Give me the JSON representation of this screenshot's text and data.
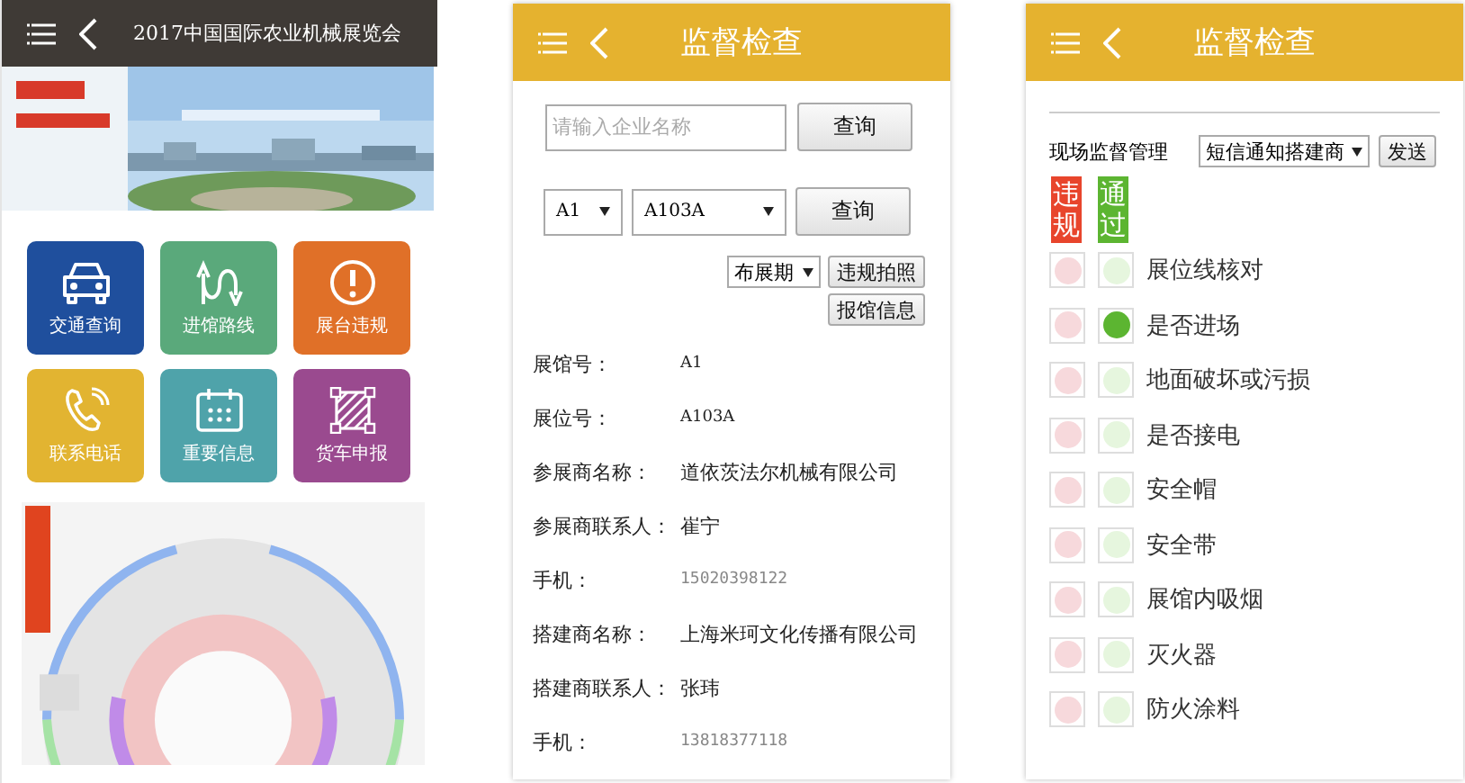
{
  "home": {
    "title": "2017中国国际农业机械展览会",
    "tiles": [
      {
        "label": "交通查询",
        "kind": "car",
        "color": "#1f4f9d"
      },
      {
        "label": "进馆路线",
        "kind": "route",
        "color": "#5aa97b"
      },
      {
        "label": "展台违规",
        "kind": "alert",
        "color": "#e07028"
      },
      {
        "label": "联系电话",
        "kind": "phone",
        "color": "#e2b431"
      },
      {
        "label": "重要信息",
        "kind": "calendar",
        "color": "#4fa3aa"
      },
      {
        "label": "货车申报",
        "kind": "frame",
        "color": "#9a4a8f"
      }
    ]
  },
  "inspection_search": {
    "title": "监督检查",
    "search": {
      "placeholder": "请输入企业名称",
      "button": "查询"
    },
    "hall_select": "A1",
    "booth_select": "A103A",
    "query_button": "查询",
    "period_select": "布展期",
    "photo_button": "违规拍照",
    "report_button": "报馆信息",
    "details": [
      {
        "label": "展馆号：",
        "value": "A1",
        "kind": "code"
      },
      {
        "label": "展位号：",
        "value": "A103A",
        "kind": "code"
      },
      {
        "label": "参展商名称：",
        "value": "道依茨法尔机械有限公司",
        "kind": "text"
      },
      {
        "label": "参展商联系人：",
        "value": "崔宁",
        "kind": "text"
      },
      {
        "label": "手机：",
        "value": "15020398122",
        "kind": "phone"
      },
      {
        "label": "搭建商名称：",
        "value": "上海米珂文化传播有限公司",
        "kind": "text"
      },
      {
        "label": "搭建商联系人：",
        "value": "张玮",
        "kind": "text"
      },
      {
        "label": "手机：",
        "value": "13818377118",
        "kind": "phone"
      }
    ]
  },
  "inspection_checklist": {
    "title": "监督检查",
    "manage_label": "现场监督管理",
    "notify_select": "短信通知搭建商",
    "send_button": "发送",
    "columns": [
      {
        "label": "违规",
        "color": "#e8452c"
      },
      {
        "label": "通过",
        "color": "#5cb531"
      }
    ],
    "items": [
      {
        "label": "展位线核对",
        "violation": false,
        "pass": false
      },
      {
        "label": "是否进场",
        "violation": false,
        "pass": true
      },
      {
        "label": "地面破坏或污损",
        "violation": false,
        "pass": false
      },
      {
        "label": "是否接电",
        "violation": false,
        "pass": false
      },
      {
        "label": "安全帽",
        "violation": false,
        "pass": false
      },
      {
        "label": "安全带",
        "violation": false,
        "pass": false
      },
      {
        "label": "展馆内吸烟",
        "violation": false,
        "pass": false
      },
      {
        "label": "灭火器",
        "violation": false,
        "pass": false
      },
      {
        "label": "防火涂料",
        "violation": false,
        "pass": false
      }
    ]
  }
}
